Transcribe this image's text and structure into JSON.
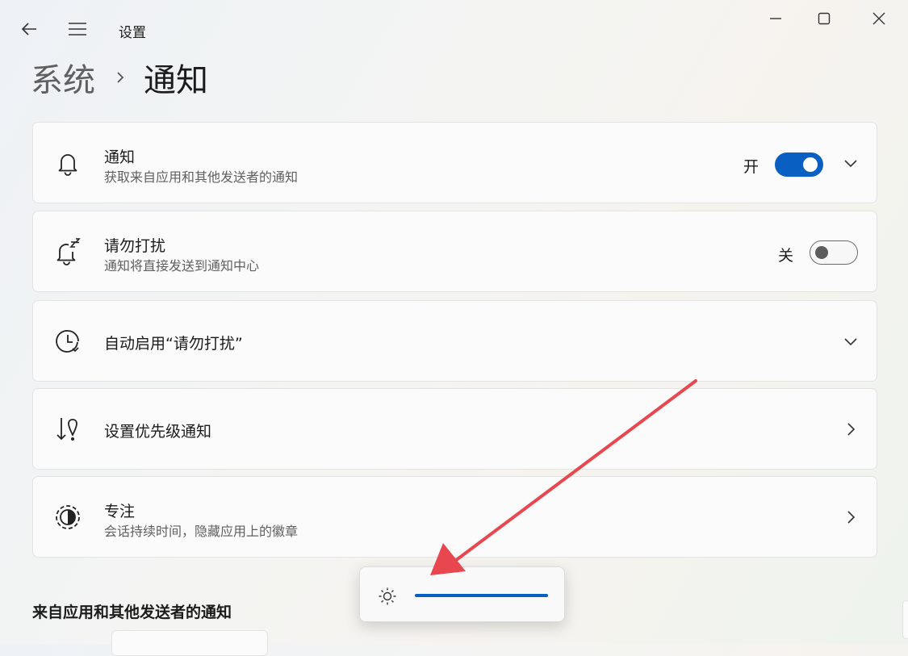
{
  "window": {
    "app_title": "设置",
    "back_icon": "back-arrow-icon",
    "menu_icon": "hamburger-menu-icon",
    "controls": [
      "minimize-icon",
      "maximize-icon",
      "close-icon"
    ]
  },
  "breadcrumb": {
    "parent": "系统",
    "current": "通知"
  },
  "cards": {
    "notifications": {
      "icon": "bell-icon",
      "title": "通知",
      "subtitle": "获取来自应用和其他发送者的通知",
      "toggle_label": "开",
      "toggle_on": true
    },
    "dnd": {
      "icon": "bell-snooze-icon",
      "title": "请勿打扰",
      "subtitle": "通知将直接发送到通知中心",
      "toggle_label": "关",
      "toggle_on": false
    },
    "auto_dnd": {
      "icon": "clock-icon",
      "title": "自动启用“请勿打扰”"
    },
    "priority": {
      "icon": "priority-sort-icon",
      "title": "设置优先级通知"
    },
    "focus": {
      "icon": "focus-icon",
      "title": "专注",
      "subtitle": "会话持续时间，隐藏应用上的徽章"
    }
  },
  "section": {
    "title": "来自应用和其他发送者的通知"
  },
  "brightness_flyout": {
    "icon": "sun-brightness-icon",
    "level": 1.0
  },
  "colors": {
    "accent": "#0a5fc2",
    "annotation_arrow": "#e8474f"
  }
}
